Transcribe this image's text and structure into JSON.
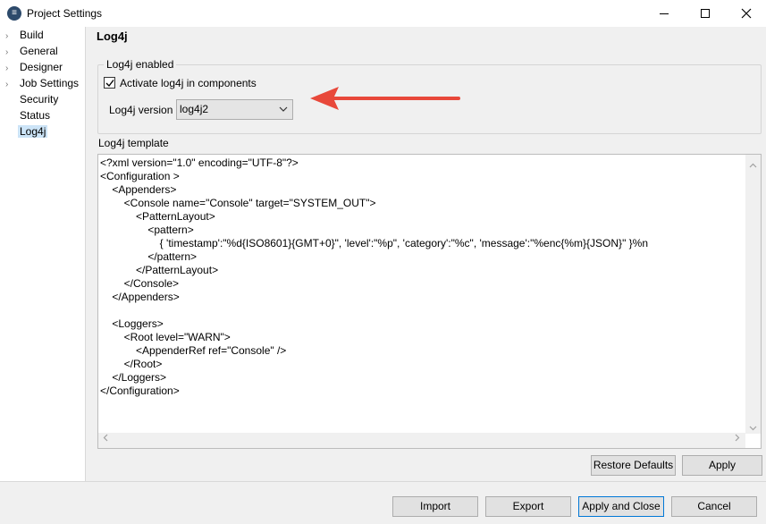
{
  "window": {
    "title": "Project Settings"
  },
  "tree": {
    "items": [
      {
        "label": "Build",
        "expandable": true
      },
      {
        "label": "General",
        "expandable": true
      },
      {
        "label": "Designer",
        "expandable": true
      },
      {
        "label": "Job Settings",
        "expandable": true
      },
      {
        "label": "Security",
        "expandable": false
      },
      {
        "label": "Status",
        "expandable": false
      },
      {
        "label": "Log4j",
        "expandable": false,
        "selected": true
      }
    ]
  },
  "panel": {
    "title": "Log4j",
    "group_legend": "Log4j enabled",
    "activate_label": "Activate log4j in components",
    "activate_checked": true,
    "version_label": "Log4j version",
    "version_value": "log4j2",
    "template_label": "Log4j template",
    "template_text": "<?xml version=\"1.0\" encoding=\"UTF-8\"?>\n<Configuration >\n    <Appenders>\n        <Console name=\"Console\" target=\"SYSTEM_OUT\">\n            <PatternLayout>\n                <pattern>\n                    { 'timestamp':\"%d{ISO8601}{GMT+0}\", 'level':\"%p\", 'category':\"%c\", 'message':\"%enc{%m}{JSON}\" }%n\n                </pattern>\n            </PatternLayout>\n        </Console>\n    </Appenders>\n\n    <Loggers>\n        <Root level=\"WARN\">\n            <AppenderRef ref=\"Console\" />\n        </Root>\n    </Loggers>\n</Configuration>",
    "restore_defaults_label": "Restore Defaults",
    "apply_label": "Apply"
  },
  "footer": {
    "import_label": "Import",
    "export_label": "Export",
    "apply_close_label": "Apply and Close",
    "cancel_label": "Cancel"
  },
  "colors": {
    "annotation_arrow": "#e8483a",
    "selection": "#cce4f7",
    "default_button_border": "#0078d7"
  },
  "icons": {
    "app": "app-logo-icon",
    "annotation": "red-arrow-icon"
  }
}
